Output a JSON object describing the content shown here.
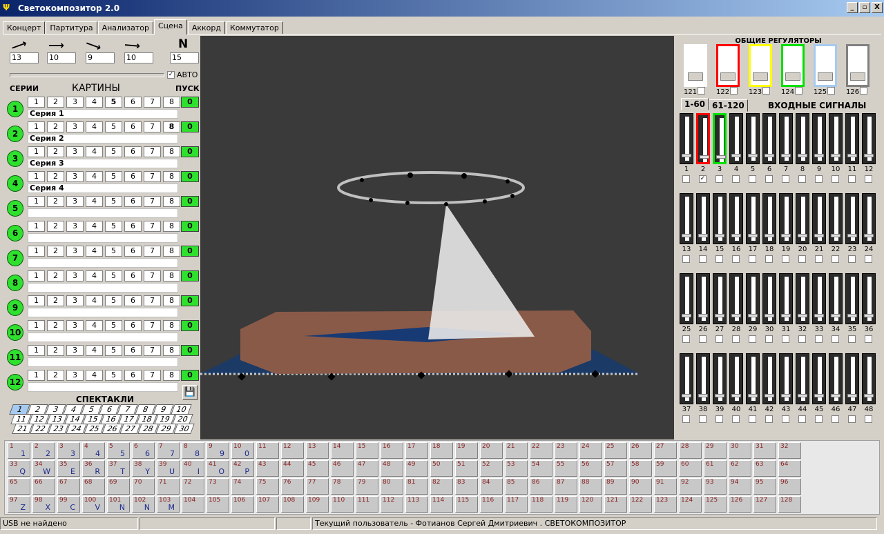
{
  "window": {
    "title": "Светокомпозитор 2.0",
    "min": "_",
    "max": "▫",
    "close": "X"
  },
  "tabs": [
    "Концерт",
    "Партитура",
    "Анализатор",
    "Сцена",
    "Аккорд",
    "Коммутатор"
  ],
  "active_tab": "Сцена",
  "arrows": {
    "values": [
      "13",
      "10",
      "9",
      "10"
    ],
    "n_label": "N",
    "n_value": "15",
    "auto_label": "АВТО",
    "auto_checked": true
  },
  "series_panel": {
    "col_series": "СЕРИИ",
    "col_pictures": "КАРТИНЫ",
    "col_start": "ПУСК",
    "buttons": [
      "1",
      "2",
      "3",
      "4",
      "5",
      "6",
      "7",
      "8"
    ],
    "rows": [
      {
        "num": "1",
        "name": "Серия 1",
        "go": "0",
        "bold": "5"
      },
      {
        "num": "2",
        "name": "Серия 2",
        "go": "0",
        "bold": "8"
      },
      {
        "num": "3",
        "name": "Серия 3",
        "go": "0",
        "bold": ""
      },
      {
        "num": "4",
        "name": "Серия 4",
        "go": "0",
        "bold": ""
      },
      {
        "num": "5",
        "name": "",
        "go": "0",
        "bold": ""
      },
      {
        "num": "6",
        "name": "",
        "go": "0",
        "bold": ""
      },
      {
        "num": "7",
        "name": "",
        "go": "0",
        "bold": ""
      },
      {
        "num": "8",
        "name": "",
        "go": "0",
        "bold": ""
      },
      {
        "num": "9",
        "name": "",
        "go": "0",
        "bold": ""
      },
      {
        "num": "10",
        "name": "",
        "go": "0",
        "bold": ""
      },
      {
        "num": "11",
        "name": "",
        "go": "0",
        "bold": ""
      },
      {
        "num": "12",
        "name": "",
        "go": "0",
        "bold": ""
      }
    ]
  },
  "spectacles": {
    "title": "СПЕКТАКЛИ",
    "selected": "1",
    "rows": [
      [
        "1",
        "2",
        "3",
        "4",
        "5",
        "6",
        "7",
        "8",
        "9",
        "10"
      ],
      [
        "11",
        "12",
        "13",
        "14",
        "15",
        "16",
        "17",
        "18",
        "19",
        "20"
      ],
      [
        "21",
        "22",
        "23",
        "24",
        "25",
        "26",
        "27",
        "28",
        "29",
        "30"
      ]
    ]
  },
  "general": {
    "title": "ОБЩИЕ РЕГУЛЯТОРЫ",
    "faders": [
      {
        "num": "121",
        "color": "#ffffff"
      },
      {
        "num": "122",
        "color": "#ff0000"
      },
      {
        "num": "123",
        "color": "#ffff00"
      },
      {
        "num": "124",
        "color": "#00e000"
      },
      {
        "num": "125",
        "color": "#a6caf0"
      },
      {
        "num": "126",
        "color": "#808080"
      }
    ]
  },
  "inputs": {
    "tabs": [
      "1-60",
      "61-120"
    ],
    "title": "ВХОДНЫЕ СИГНАЛЫ",
    "checked": [
      "2"
    ],
    "rows": [
      [
        "1",
        "2",
        "3",
        "4",
        "5",
        "6",
        "7",
        "8",
        "9",
        "10",
        "11",
        "12"
      ],
      [
        "13",
        "14",
        "15",
        "16",
        "17",
        "18",
        "19",
        "20",
        "21",
        "22",
        "23",
        "24"
      ],
      [
        "25",
        "26",
        "27",
        "28",
        "29",
        "30",
        "31",
        "32",
        "33",
        "34",
        "35",
        "36"
      ],
      [
        "37",
        "38",
        "39",
        "40",
        "41",
        "42",
        "43",
        "44",
        "45",
        "46",
        "47",
        "48"
      ]
    ],
    "highlight": {
      "2": "#ff0000",
      "3": "#00e000"
    }
  },
  "keypad_letters": {
    "1": "1",
    "2": "2",
    "3": "3",
    "4": "4",
    "5": "5",
    "6": "6",
    "7": "7",
    "8": "8",
    "9": "9",
    "10": "0",
    "33": "Q",
    "34": "W",
    "35": "E",
    "36": "R",
    "37": "T",
    "38": "Y",
    "39": "U",
    "40": "I",
    "41": "O",
    "42": "P",
    "97": "Z",
    "98": "X",
    "99": "C",
    "100": "V",
    "101": "N",
    "102": "N",
    "103": "M"
  },
  "status": {
    "usb": "USB не найдено",
    "user": "Текущий пользователь - Фотианов Сергей Дмитриевич . СВЕТОКОМПОЗИТОР"
  }
}
